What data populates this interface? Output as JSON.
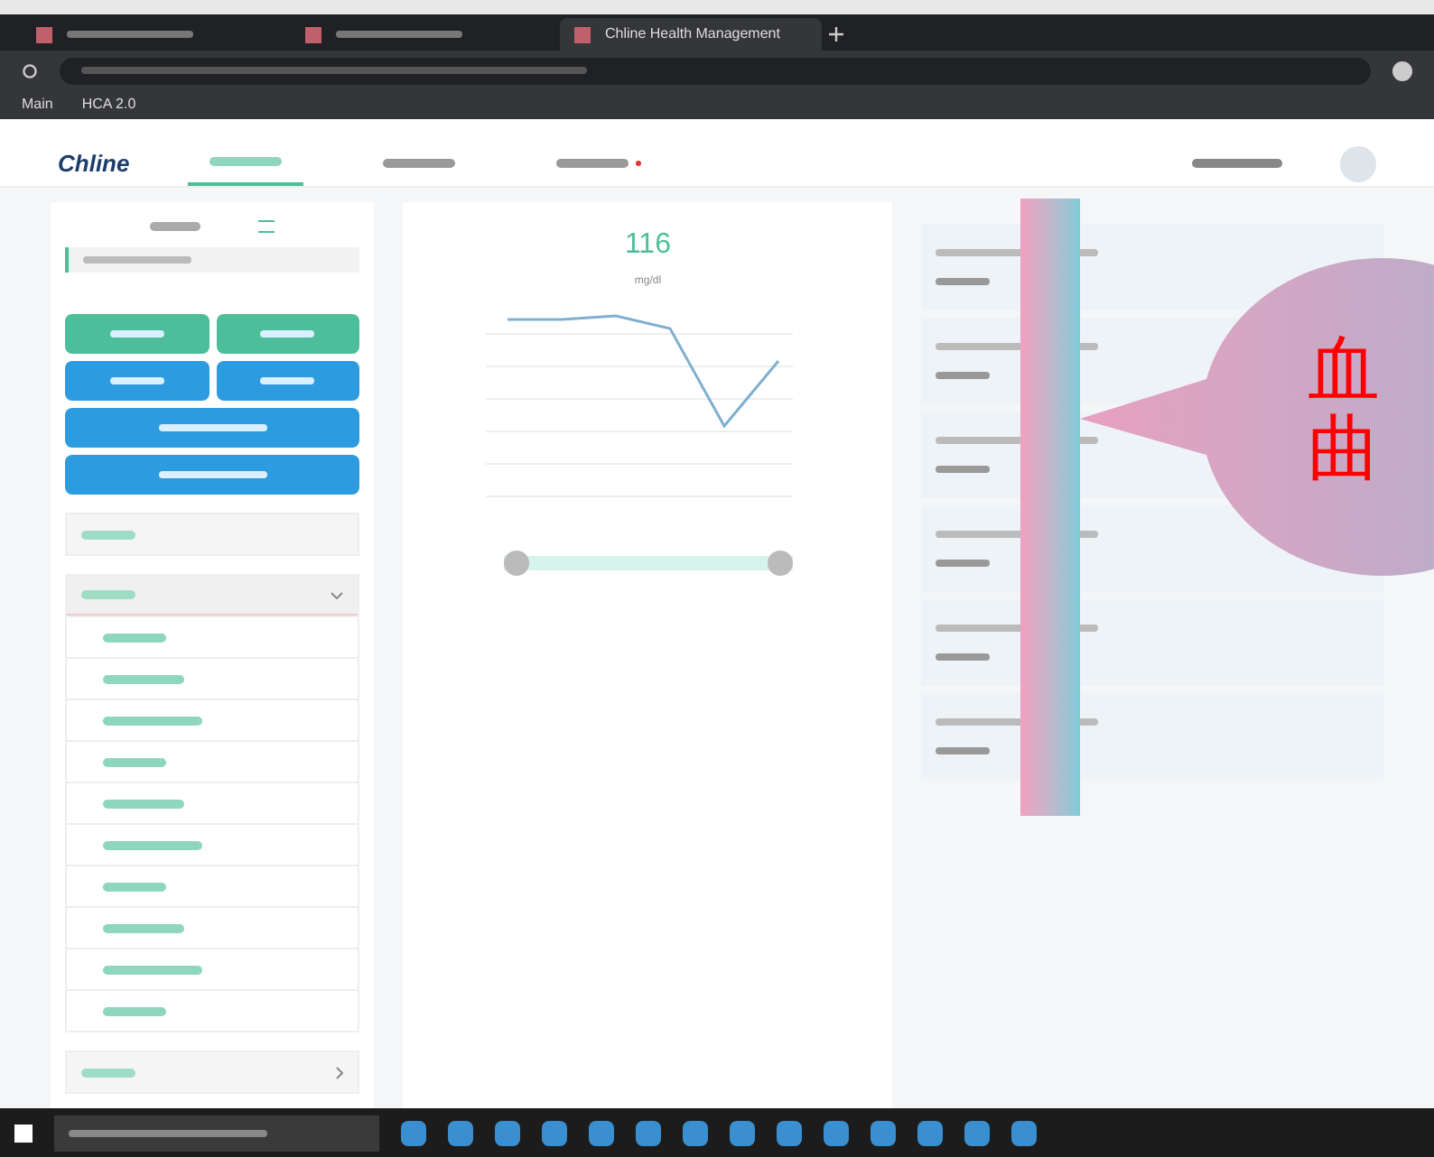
{
  "browser": {
    "tabs": [
      {
        "selected": false
      },
      {
        "selected": false
      },
      {
        "title": "Chline Health Management",
        "selected": true
      }
    ],
    "bookmarks": [
      {
        "label": "Main"
      },
      {
        "label": "HCA 2.0"
      }
    ]
  },
  "app": {
    "logo": "Chline",
    "nav": [
      {
        "selected": true
      },
      {
        "selected": false
      },
      {
        "selected": false,
        "badge": true
      }
    ]
  },
  "sidebar": {
    "buttons": [
      {
        "kind": "half",
        "color": "#4cbf9a"
      },
      {
        "kind": "half",
        "color": "#4cbf9a"
      },
      {
        "kind": "half",
        "color": "#2d9be0"
      },
      {
        "kind": "half",
        "color": "#2d9be0"
      },
      {
        "kind": "full",
        "color": "#2d9be0"
      },
      {
        "kind": "full",
        "color": "#2d9be0"
      }
    ],
    "sections": [
      {
        "kind": "link"
      },
      {
        "kind": "group",
        "expanded": true,
        "items": [
          {
            "selected": false
          },
          {
            "selected": false
          },
          {
            "selected": false
          },
          {
            "selected": false
          },
          {
            "selected": false
          },
          {
            "selected": false
          },
          {
            "selected": false
          },
          {
            "selected": false
          },
          {
            "selected": false
          },
          {
            "selected": false
          }
        ]
      },
      {
        "kind": "group",
        "expanded": false
      }
    ]
  },
  "reading": {
    "value": "116",
    "unit": "mg/dl",
    "zoom": {
      "level": 1
    }
  },
  "callout": {
    "lines": [
      "血",
      "曲"
    ]
  }
}
